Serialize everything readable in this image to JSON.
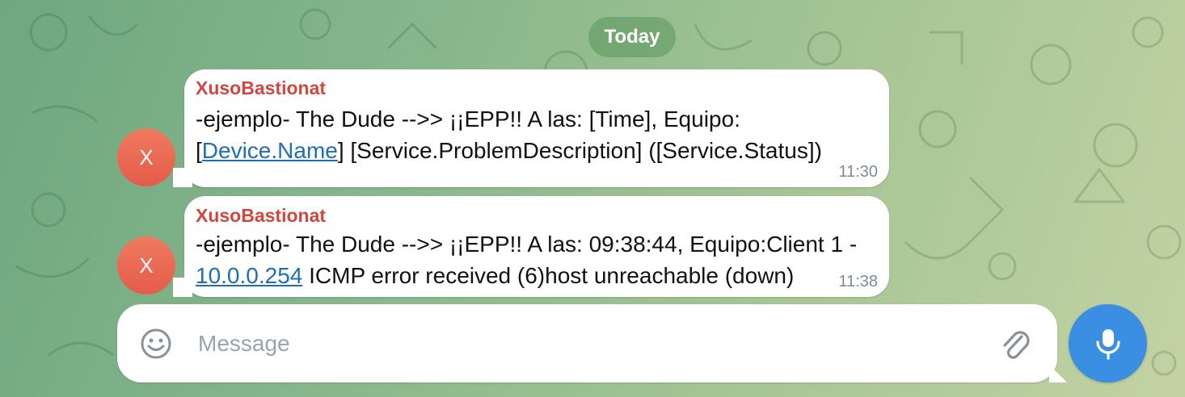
{
  "date_separator": "Today",
  "messages": [
    {
      "avatar_initial": "X",
      "sender": "XusoBastionat",
      "line1": "-ejemplo- The Dude -->> ¡¡EPP!! A las: [Time], Equipo:",
      "line2_prefix": "[",
      "line2_link": "Device.Name",
      "line2_suffix": "] [Service.ProblemDescription] ([Service.Status])",
      "time": "11:30"
    },
    {
      "avatar_initial": "X",
      "sender": "XusoBastionat",
      "line1": "-ejemplo- The Dude -->> ¡¡EPP!! A las: 09:38:44, Equipo:Client 1 -",
      "line2_link": "10.0.0.254",
      "line2_suffix": " ICMP error received (6)host unreachable (down)",
      "time": "11:38"
    }
  ],
  "composer": {
    "placeholder": "Message",
    "emoji_icon": "smiley-icon",
    "attach_icon": "paperclip-icon",
    "send_icon": "microphone-icon"
  },
  "colors": {
    "sender": "#d1473f",
    "link": "#1f6db8",
    "mic_button": "#3a8fe2",
    "avatar": "#e45c4a"
  }
}
